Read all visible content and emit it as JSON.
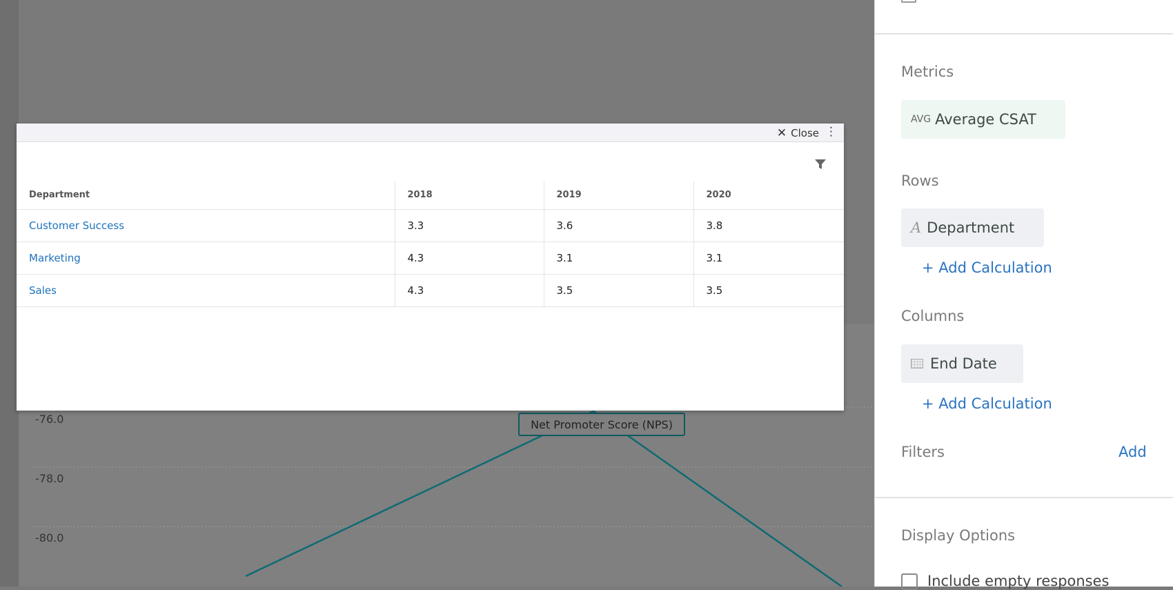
{
  "chart": {
    "y_ticks": [
      "-76.0",
      "-78.0",
      "-80.0"
    ],
    "series_label": "Net Promoter Score (NPS)",
    "line_color": "#0e6a73"
  },
  "modal": {
    "close_label": "Close",
    "columns": [
      "Department",
      "2018",
      "2019",
      "2020"
    ],
    "rows": [
      [
        "Customer Success",
        "3.3",
        "3.6",
        "3.8"
      ],
      [
        "Marketing",
        "4.3",
        "3.1",
        "3.1"
      ],
      [
        "Sales",
        "4.3",
        "3.5",
        "3.5"
      ]
    ]
  },
  "panel": {
    "metrics_title": "Metrics",
    "metric_prefix": "AVG",
    "metric_name": "Average CSAT",
    "rows_title": "Rows",
    "row_field": "Department",
    "add_calc_rows": "+ Add Calculation",
    "columns_title": "Columns",
    "column_field": "End Date",
    "add_calc_cols": "+ Add Calculation",
    "filters_title": "Filters",
    "filters_add": "Add",
    "display_title": "Display Options",
    "include_empty": "Include empty responses"
  }
}
